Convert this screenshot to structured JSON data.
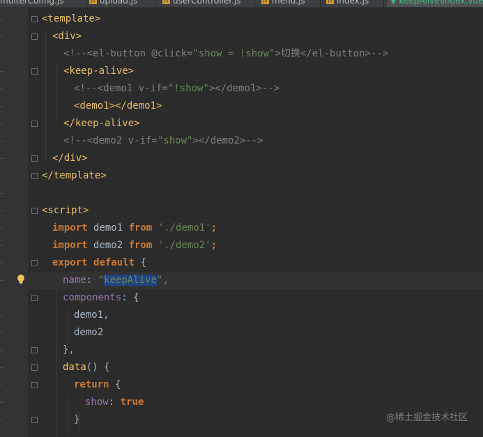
{
  "tabs": [
    {
      "label": "multerConfig.js",
      "icon": "js-file-icon"
    },
    {
      "label": "upload.js",
      "icon": "js-file-icon"
    },
    {
      "label": "userController.js",
      "icon": "js-file-icon"
    },
    {
      "label": "menu.js",
      "icon": "js-file-icon"
    },
    {
      "label": "index.js",
      "icon": "js-file-icon"
    },
    {
      "label": "keepAlive\\index.vue",
      "icon": "vue-file-icon",
      "active": true
    }
  ],
  "code": {
    "l1_tag": "<template>",
    "l2_tag": "<div>",
    "l3_cmt_a": "<!--<el-button @click=",
    "l3_cmt_str": "\"show = !show\"",
    "l3_cmt_b": ">切换</el-button>-->",
    "l4_tag": "<keep-alive>",
    "l5_cmt_a": "<!--<demo1 v-if=",
    "l5_cmt_str": "\"!show\"",
    "l5_cmt_b": "></demo1>-->",
    "l6_tag": "<demo1></demo1>",
    "l7_tag": "</keep-alive>",
    "l8_cmt_a": "<!--<demo2 v-if=",
    "l8_cmt_str": "\"show\"",
    "l8_cmt_b": "></demo2>-->",
    "l9_tag": "</div>",
    "l10_tag": "</template>",
    "l12_tag": "<script>",
    "kw_import": "import",
    "kw_from": "from",
    "demo1": "demo1",
    "demo2": "demo2",
    "path1": "'./demo1'",
    "path2": "'./demo2'",
    "semi": ";",
    "kw_export": "export",
    "kw_default": "default",
    "brace_open": "{",
    "name_key": "name",
    "colon": ":",
    "quote": "\"",
    "name_val": "keepAlive",
    "quote_comma": "\",",
    "components_key": "components",
    "demo1_comma": "demo1,",
    "demo2_plain": "demo2",
    "close_comma": "},",
    "data_fn": "data",
    "parens": "()",
    "kw_return": "return",
    "show_key": "show",
    "kw_true": "true",
    "brace_close": "}"
  },
  "watermark": "@稀土掘金技术社区",
  "colors": {
    "background": "#2b2b2b",
    "tag": "#e8bf6a",
    "string": "#6a8759",
    "comment": "#808080",
    "keyword": "#cc7832",
    "property": "#9876aa",
    "function": "#ffc66d",
    "selection": "#214283"
  }
}
